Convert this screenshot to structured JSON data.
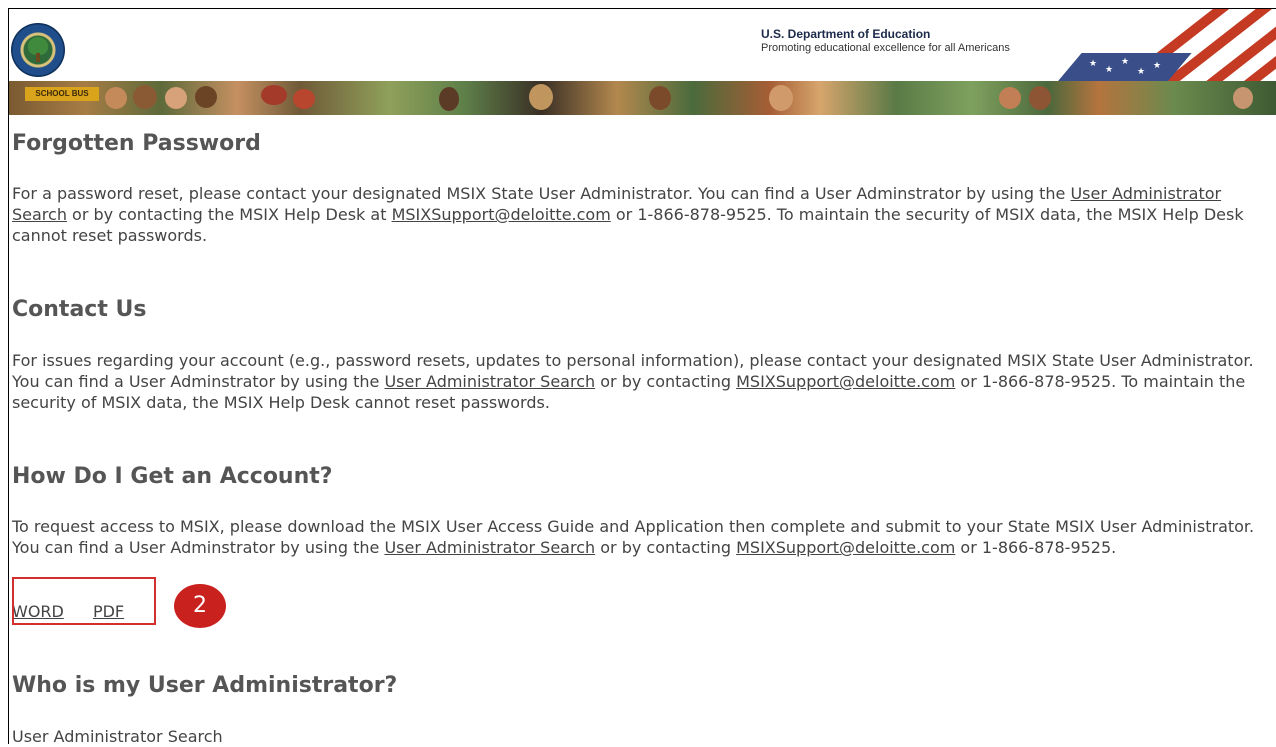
{
  "header": {
    "dept_title": "U.S. Department of Education",
    "dept_subtitle": "Promoting educational excellence for all Americans",
    "bus_label": "SCHOOL BUS"
  },
  "sections": {
    "forgotten": {
      "title": "Forgotten Password",
      "text1": "For a password reset, please contact your designated MSIX State User Administrator. You can find a User Adminstrator by using the ",
      "link1": "User Administrator Search",
      "text2": " or by contacting the MSIX Help Desk at ",
      "link2": "MSIXSupport@deloitte.com",
      "text3": " or 1-866-878-9525. To maintain the security of MSIX data, the MSIX Help Desk cannot reset passwords."
    },
    "contact": {
      "title": "Contact Us",
      "text1": "For issues regarding your account (e.g., password resets, updates to personal information), please contact your designated MSIX State User Administrator. You can find a User Adminstrator by using the ",
      "link1": "User Administrator Search",
      "text2": " or by contacting ",
      "link2": "MSIXSupport@deloitte.com",
      "text3": " or 1-866-878-9525. To maintain the security of MSIX data, the MSIX Help Desk cannot reset passwords."
    },
    "account": {
      "title": "How Do I Get an Account?",
      "text1": "To request access to MSIX, please download the MSIX User Access Guide and Application then complete and submit to your State MSIX User Administrator. You can find a User Adminstrator by using the ",
      "link1": "User Administrator Search",
      "text2": " or by contacting ",
      "link2": "MSIXSupport@deloitte.com",
      "text3": " or 1-866-878-9525.",
      "word_link": "WORD",
      "pdf_link": "PDF"
    },
    "admin": {
      "title": "Who is my User Administrator?",
      "text": "User Administrator Search"
    }
  },
  "annotation": {
    "step_number": "2",
    "color": "#c9211e"
  }
}
